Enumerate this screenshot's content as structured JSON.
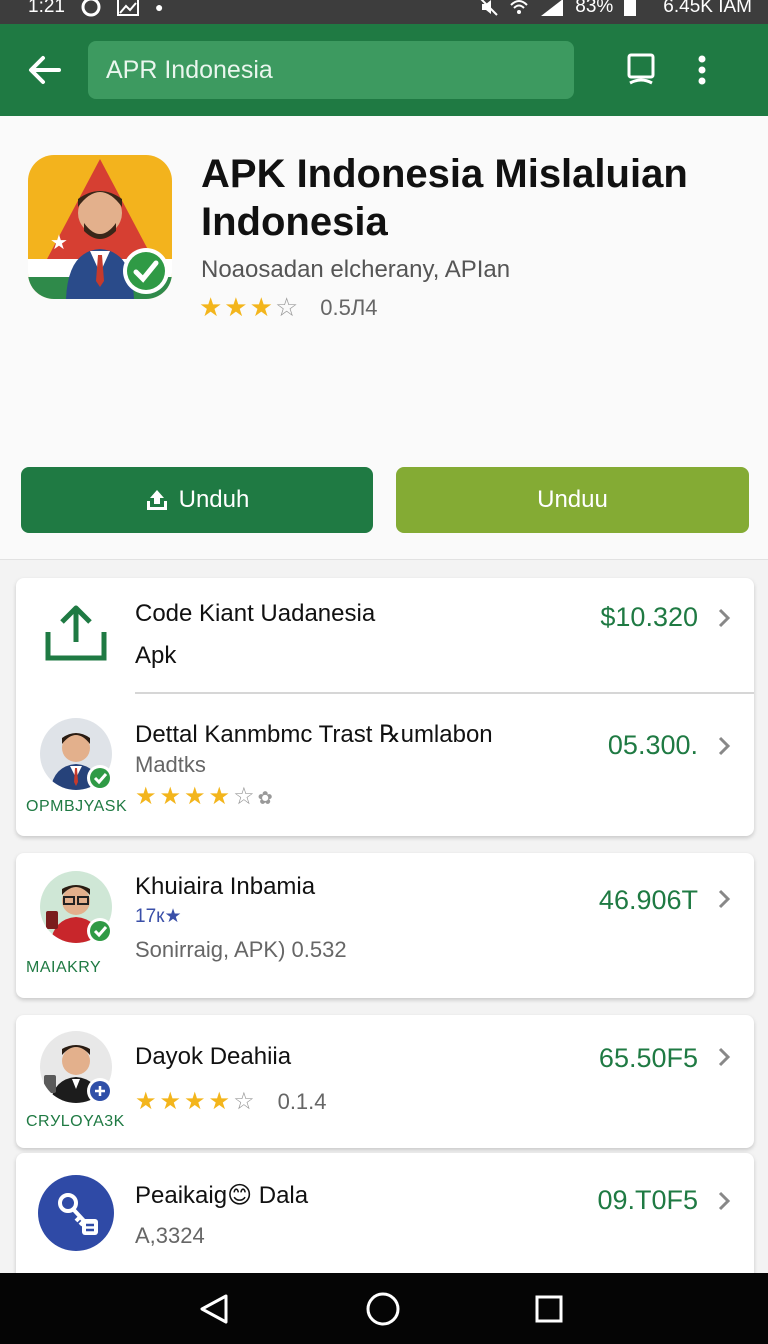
{
  "status_bar": {
    "time": "1:21",
    "battery": "83%",
    "speed": "6.45K IAM"
  },
  "app_bar": {
    "search_value": "APR Indonesia",
    "back_icon": "arrow-left-icon",
    "bookmark_icon": "save-icon",
    "menu_icon": "more-vert-icon"
  },
  "hero": {
    "title": "APK Indonesia Mislaluian Indonesia",
    "subtitle": "Noaosadan elcherany, APIan",
    "rating_text": "0.5Л4",
    "stars": 3.5,
    "primary_button": "Unduh",
    "secondary_button": "Unduu"
  },
  "list": [
    {
      "title": "Code Kiant Uadanesia",
      "subtitle": "Apk",
      "price": "$10.320",
      "icon": "upload-icon"
    },
    {
      "title": "Dettal Kanmbmc Trast ℞umlabon",
      "subtitle": "Madtks",
      "price": "05.300.",
      "caption": "OPMBJYASK",
      "stars": 4.5
    },
    {
      "title": "Khuiaira Inbamia",
      "subtitle": "17к★",
      "subtitle2": "Sonirraig, APK)  0.532",
      "price": "46.906T",
      "caption": "MAIAKRY"
    },
    {
      "title": "Dayok Deahiia",
      "rating_text": "0.1.4",
      "price": "65.50F5",
      "caption": "CRУLOYA3K",
      "stars": 4.5
    },
    {
      "title": "Peaikaig😊 Dala",
      "subtitle": "A,3324",
      "price": "09.T0F5",
      "icon": "key-icon"
    }
  ],
  "colors": {
    "brand_green": "#1f7a43",
    "accent_lime": "#84ab34",
    "star_gold": "#f3b51c"
  }
}
